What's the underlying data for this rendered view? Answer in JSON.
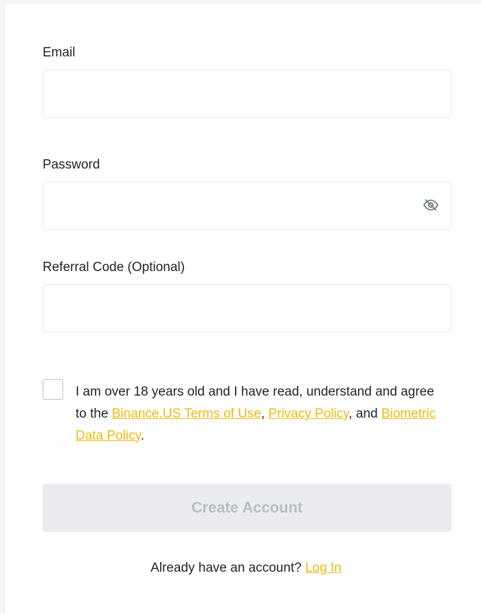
{
  "form": {
    "email": {
      "label": "Email",
      "value": "",
      "placeholder": ""
    },
    "password": {
      "label": "Password",
      "value": "",
      "placeholder": ""
    },
    "referral": {
      "label": "Referral Code (Optional)",
      "value": "",
      "placeholder": ""
    }
  },
  "agreement": {
    "checked": false,
    "text_1": "I am over 18 years old and I have read, understand and agree to the ",
    "terms_link": "Binance.US Terms of Use",
    "sep_1": ", ",
    "privacy_link": "Privacy Policy",
    "sep_2": ", and ",
    "biometric_link": "Biometric Data Policy",
    "end": "."
  },
  "create_button": {
    "label": "Create Account",
    "enabled": false
  },
  "login": {
    "prompt": "Already have an account? ",
    "link": "Log In"
  },
  "colors": {
    "accent": "#f0b90b",
    "button_disabled_bg": "#eaecef",
    "button_disabled_text": "#b7bdc6"
  },
  "icons": {
    "password_toggle": "eye-slash-icon"
  }
}
